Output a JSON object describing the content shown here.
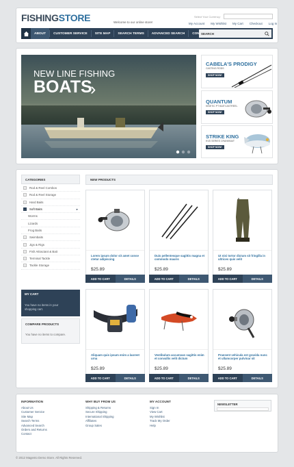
{
  "header": {
    "logo_part1": "FISHING",
    "logo_part2": "STORE",
    "welcome": "Welcome to our online store!",
    "currency_label": "Select Your Currency:",
    "top_links": [
      "My Account",
      "My Wishlist",
      "My Cart",
      "Checkout",
      "Log In"
    ]
  },
  "nav": {
    "items": [
      "ABOUT",
      "CUSTOMER SERVICE",
      "SITE MAP",
      "SEARCH TERMS",
      "ADVANCED SEARCH",
      "CONTACTS"
    ],
    "search_label": "SEARCH"
  },
  "banner": {
    "subtitle": "NEW LINE FISHING",
    "title": "BOATS",
    "arrow": "›",
    "promos": [
      {
        "title": "CABELA'S PRODIGY",
        "subtitle": "CASTING RODS",
        "button": "SHOP NOW!"
      },
      {
        "title": "QUANTUM",
        "subtitle": "KINETIC PT BAITCASTREEL",
        "button": "SHOP NOW!"
      },
      {
        "title": "STRIKE KING",
        "subtitle": "KVD SERIES CRANKBAIT",
        "button": "SHOP NOW!"
      }
    ]
  },
  "sidebar": {
    "categories_title": "CATEGORIES",
    "categories": [
      {
        "label": "Rod & Reel Combos",
        "box": "+",
        "sub": false
      },
      {
        "label": "Rod & Reel Storage",
        "box": "+",
        "sub": false
      },
      {
        "label": "Hard Baits",
        "box": "+",
        "sub": false
      },
      {
        "label": "Soft Baits",
        "box": "-",
        "sub": false,
        "active": true
      },
      {
        "label": "Worms",
        "box": "",
        "sub": true
      },
      {
        "label": "Lizards",
        "box": "",
        "sub": true
      },
      {
        "label": "Frog Baits",
        "box": "",
        "sub": true
      },
      {
        "label": "Swimbaits",
        "box": "+",
        "sub": false
      },
      {
        "label": "Jigs & Rigs",
        "box": "+",
        "sub": false
      },
      {
        "label": "Fish Attractant & Bait",
        "box": "+",
        "sub": false
      },
      {
        "label": "Terminal Tackle",
        "box": "+",
        "sub": false
      },
      {
        "label": "Tackle Storage",
        "box": "+",
        "sub": false
      }
    ],
    "cart_title": "MY CART",
    "cart_text": "You have no items in your shopping cart.",
    "compare_title": "COMPARE PRODUCTS",
    "compare_text": "You have no items to compare."
  },
  "products": {
    "title": "NEW PRODUCTS",
    "add_label": "ADD TO CART",
    "details_label": "DETAILS",
    "items": [
      {
        "desc": "Lorem ipsum dolor sit amet conse ctetur adipiscing",
        "price": "$25.89",
        "icon": "reel-icon"
      },
      {
        "desc": "Duis pellentesque sagittis magna et commodo mauris",
        "price": "$25.89",
        "icon": "fishing-rods-icon"
      },
      {
        "desc": "Ut nisi tortor dictum sit fringilla in ultrices quis velit",
        "price": "$25.89",
        "icon": "waders-icon"
      },
      {
        "desc": "Aliquam quis ipsum enim a laoreet urna",
        "price": "$25.89",
        "icon": "tackle-belt-icon"
      },
      {
        "desc": "Vestibulum accumsan sagittis enim et convallis velit dictum",
        "price": "$25.89",
        "icon": "lure-icon"
      },
      {
        "desc": "Praesent vehicula est gravida nunc et ullamcorper pulvinar sit",
        "price": "$25.89",
        "icon": "spinning-reel-icon"
      }
    ]
  },
  "footer": {
    "columns": [
      {
        "title": "INFORMATION",
        "links": [
          "About Us",
          "Customer Service",
          "Site Map",
          "Search Terms",
          "Advanced Search",
          "Orders and Returns",
          "Contact"
        ]
      },
      {
        "title": "WHY BUY FROM US",
        "links": [
          "Shipping & Returns",
          "Secure Shipping",
          "International Shipping",
          "Affiliates",
          "Group Sales"
        ]
      },
      {
        "title": "MY ACCOUNT",
        "links": [
          "Sign In",
          "View Cart",
          "My Wishlist",
          "Track My Order",
          "Help"
        ]
      }
    ],
    "newsletter_title": "NEWSLETTER",
    "copyright": "© 2012 Magento Demo Store. All Rights Reserved."
  },
  "colors": {
    "nav": "#2e4257",
    "accent": "#2e6f9e",
    "background": "#e4e6e8"
  }
}
